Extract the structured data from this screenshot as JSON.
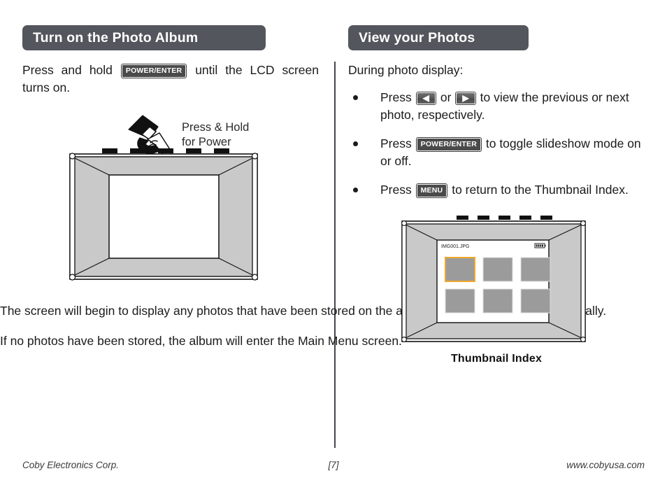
{
  "page": {
    "number_label": "[7]",
    "footer_left": "Coby Electronics Corp.",
    "footer_right": "www.cobyusa.com"
  },
  "theme": {
    "heading_bar": "#53565c",
    "heading_text": "#ffffff",
    "body_text": "#1b1b1b",
    "divider": "#44474d",
    "key_badge_bg": "#4a4a4a",
    "bezel_gray": "#c9c9c9",
    "thumbnail_gray": "#9b9b9b",
    "thumbnail_selected_border": "#f0a828",
    "screen_white": "#ffffff",
    "outline": "#000000"
  },
  "left_column": {
    "heading": "Turn on the Photo Album",
    "intro_prefix": "Press and hold",
    "intro_key": "POWER/ENTER",
    "intro_suffix": "until the LCD screen turns on.",
    "annotation_line1": "Press & Hold",
    "annotation_line2": "for Power",
    "paragraph_2": "The screen will begin to display any photos that have been stored on the album’s internal memory automatically.",
    "paragraph_3": "If no photos have been stored, the album will enter the Main Menu screen.",
    "device": {
      "name": "photo-album-front-view",
      "top_button_count": 5
    }
  },
  "right_column": {
    "heading": "View your Photos",
    "intro": "During photo display:",
    "bullets": [
      {
        "segments": [
          "Press",
          "KEY:◀",
          "or",
          "KEY:▶",
          "to view the previous or next photo, respectively."
        ],
        "text_before_first_key": "Press",
        "key1": "◀",
        "mid_text": "or",
        "key2": "▶",
        "text_after": "to view the previous or next photo, respectively."
      },
      {
        "text_before_first_key": "Press",
        "key1": "POWER/ENTER",
        "text_after": "to toggle slideshow mode on or off."
      },
      {
        "text_before_first_key": "Press",
        "key1": "MENU",
        "text_after": "to return to the Thumbnail Index."
      }
    ],
    "device": {
      "name": "photo-album-thumbnail-index-view",
      "caption": "Thumbnail Index",
      "screen_filename": "IMG001.JPG",
      "battery_icon": "battery-icon",
      "thumbnail_count": 6,
      "selected_thumbnail_index": 0,
      "top_button_count": 5
    }
  }
}
